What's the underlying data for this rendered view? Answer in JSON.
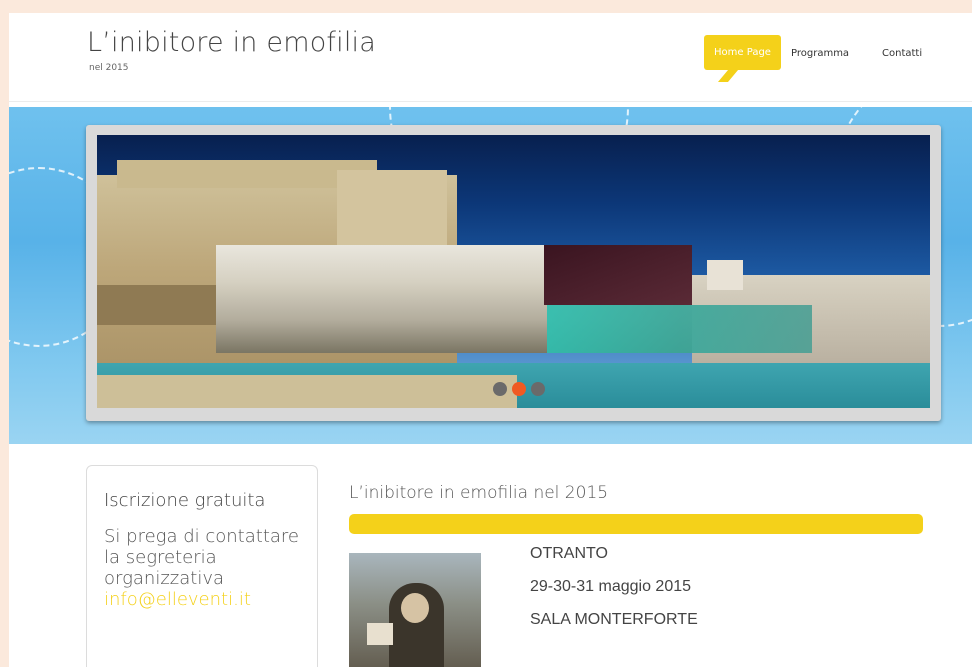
{
  "header": {
    "title": "L’inibitore  in emofilia",
    "subtitle": "nel 2015",
    "nav": {
      "home": "Home Page",
      "programma": "Programma",
      "contatti": "Contatti"
    }
  },
  "slider": {
    "dots": 3,
    "active_index": 1
  },
  "sidebar": {
    "title": "Iscrizione gratuita",
    "text": "Si prega di contattare la segreteria organizzativa",
    "email": "info@elleventi.it"
  },
  "main": {
    "title": "L’inibitore in emofilia nel 2015",
    "location": "OTRANTO",
    "dates": "29-30-31 maggio 2015",
    "venue": "SALA MONTERFORTE"
  },
  "colors": {
    "accent": "#f4d11a",
    "active_dot": "#f05a22",
    "page_bg": "#fbe9dc"
  }
}
